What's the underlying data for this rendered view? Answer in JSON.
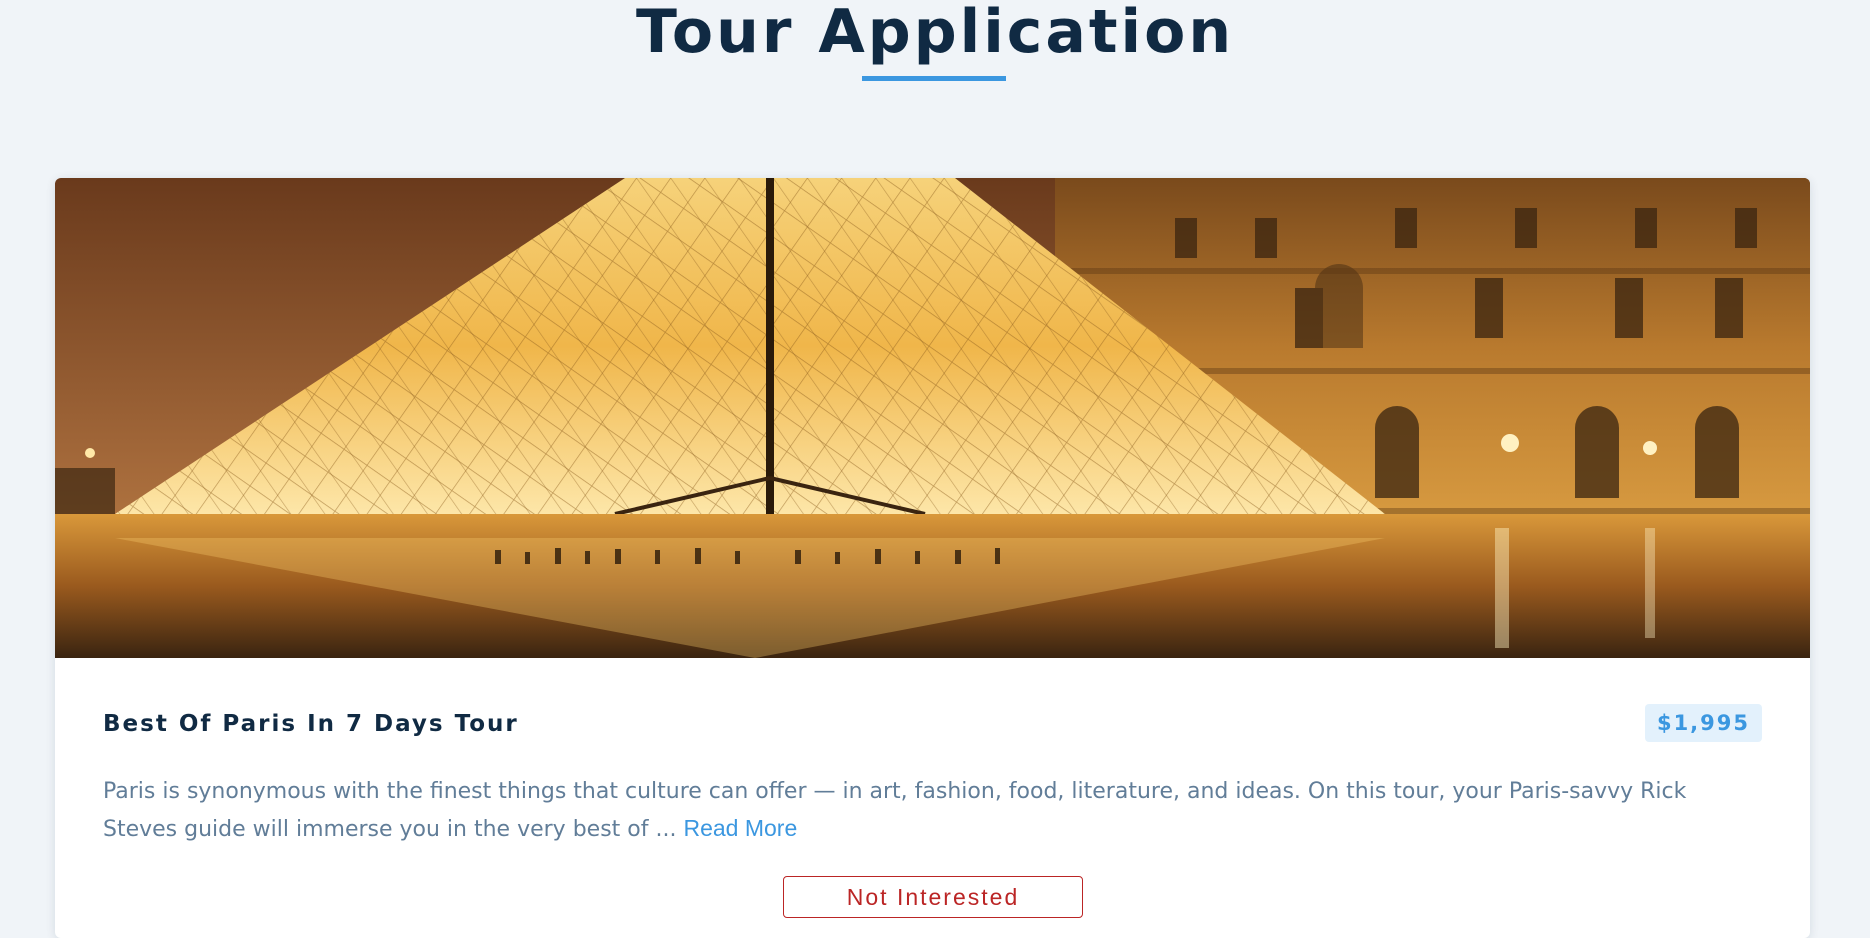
{
  "page": {
    "title": "Tour Application"
  },
  "colors": {
    "background": "#f0f4f8",
    "title": "#102a43",
    "accent": "#3b97e0",
    "description": "#617d98",
    "danger": "#bb2525"
  },
  "tour": {
    "image_icon": "louvre-pyramid-photo",
    "name": "Best Of Paris In 7 Days Tour",
    "price": "$1,995",
    "description": "Paris is synonymous with the finest things that culture can offer — in art, fashion, food, literature, and ideas. On this tour, your Paris-savvy Rick Steves guide will immerse you in the very best of ...",
    "read_more_label": "Read More",
    "not_interested_label": "Not Interested"
  }
}
